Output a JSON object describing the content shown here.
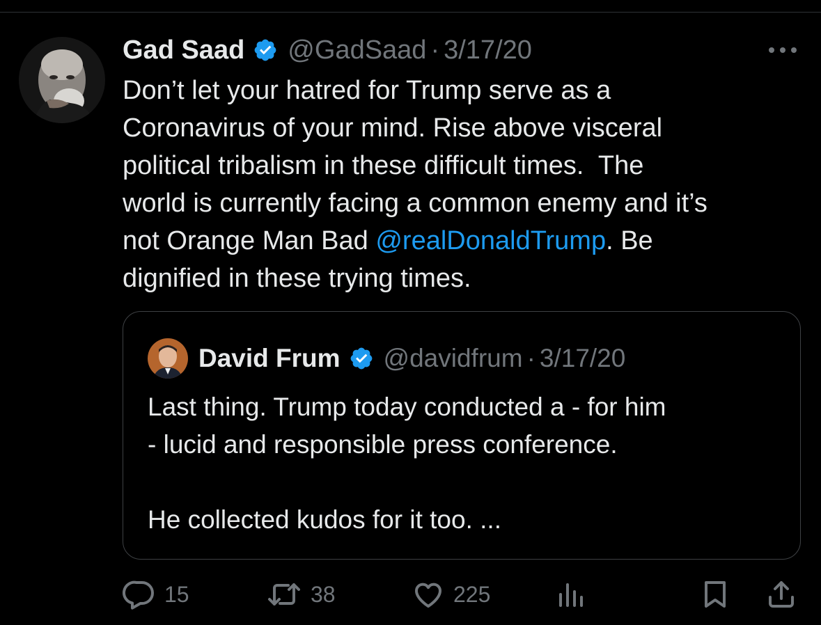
{
  "tweet": {
    "author": {
      "display_name": "Gad Saad",
      "handle": "@GadSaad",
      "verified": true
    },
    "separator": "·",
    "date": "3/17/20",
    "text_before_mention": "Don’t let your hatred for Trump serve as a\nCoronavirus of your mind. Rise above visceral\npolitical tribalism in these difficult times.  The\nworld is currently facing a common enemy and it’s\nnot Orange Man Bad ",
    "mention": "@realDonaldTrump",
    "text_after_mention": ". Be\ndignified in these trying times."
  },
  "quoted_tweet": {
    "author": {
      "display_name": "David Frum",
      "handle": "@davidfrum",
      "verified": true
    },
    "separator": "·",
    "date": "3/17/20",
    "text": "Last thing. Trump today conducted a - for him\n- lucid and responsible press conference.\n\nHe collected kudos for it too. ..."
  },
  "actions": {
    "replies": "15",
    "reposts": "38",
    "likes": "225"
  },
  "icons": {
    "more": "more-horizontal-icon",
    "verified": "verified-badge-icon",
    "reply": "reply-icon",
    "repost": "repost-icon",
    "like": "heart-icon",
    "views": "views-icon",
    "bookmark": "bookmark-icon",
    "share": "share-icon"
  },
  "colors": {
    "background": "#000000",
    "text_primary": "#e7e9ea",
    "text_secondary": "#71767b",
    "accent": "#1d9bf0",
    "border": "#3e4144"
  }
}
